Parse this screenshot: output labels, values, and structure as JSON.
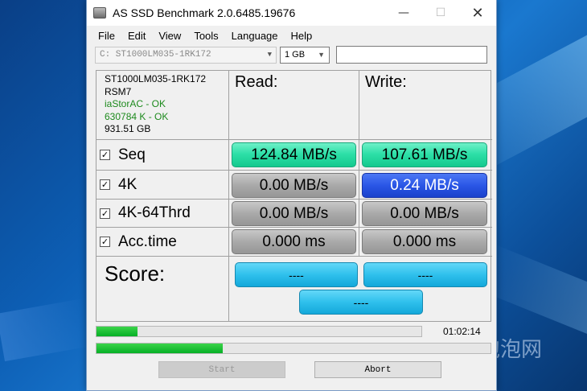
{
  "window": {
    "title": "AS SSD Benchmark 2.0.6485.19676"
  },
  "titlebar_buttons": {
    "minimize": "—",
    "maximize": "☐",
    "close": "✕"
  },
  "menu": [
    "File",
    "Edit",
    "View",
    "Tools",
    "Language",
    "Help"
  ],
  "drive_select": {
    "value": "C: ST1000LM035-1RK172"
  },
  "size_select": {
    "value": "1 GB"
  },
  "drive_info": {
    "model": "ST1000LM035-1RK172",
    "firmware": "RSM7",
    "driver": "iaStorAC - OK",
    "alignment": "630784 K - OK",
    "capacity": "931.51 GB"
  },
  "headers": {
    "read": "Read:",
    "write": "Write:"
  },
  "rows": [
    {
      "label": "Seq",
      "read": "124.84 MB/s",
      "write": "107.61 MB/s"
    },
    {
      "label": "4K",
      "read": "0.00 MB/s",
      "write": "0.24 MB/s"
    },
    {
      "label": "4K-64Thrd",
      "read": "0.00 MB/s",
      "write": "0.00 MB/s"
    },
    {
      "label": "Acc.time",
      "read": "0.000 ms",
      "write": "0.000 ms"
    }
  ],
  "score": {
    "label": "Score:",
    "read": "----",
    "write": "----",
    "total": "----"
  },
  "progress": {
    "elapsed": "01:02:14",
    "task_fraction": 0.125,
    "overall_fraction": 0.32
  },
  "buttons": {
    "start": "Start",
    "abort": "Abort"
  },
  "watermark": "泡泡网",
  "colors": {
    "green": "#2ee0a8",
    "gray": "#a9a9a9",
    "blue": "#2a56e6",
    "cyan": "#2fc0ec",
    "progress": "#06b025"
  }
}
